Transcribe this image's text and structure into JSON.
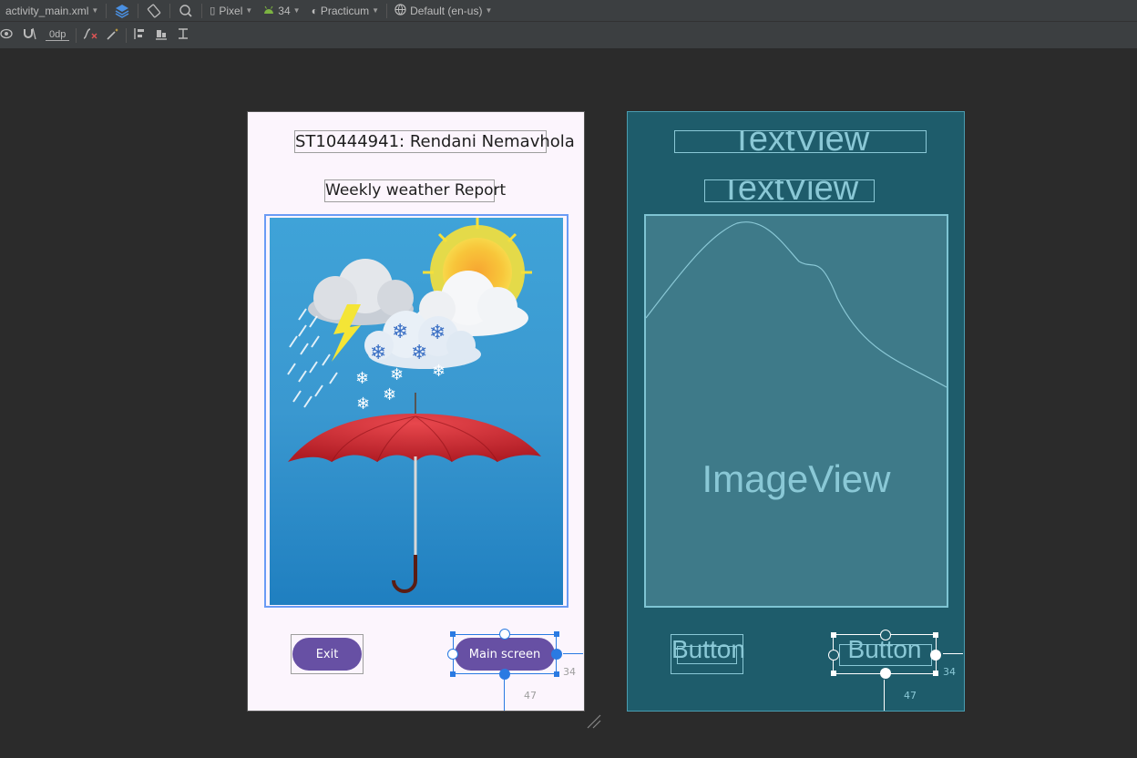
{
  "toolbar": {
    "file_name": "activity_main.xml",
    "device": "Pixel",
    "api_level": "34",
    "theme": "Practicum",
    "locale": "Default (en-us)",
    "margin_value": "0dp"
  },
  "design": {
    "title_text": "ST10444941: Rendani Nemavhola",
    "subtitle_text": "Weekly weather Report",
    "exit_button_label": "Exit",
    "main_button_label": "Main screen",
    "constraint_right": "34",
    "constraint_bottom": "47"
  },
  "blueprint": {
    "textview_label_1": "TextView",
    "textview_label_2": "TextView",
    "imageview_label": "ImageView",
    "button_label_1": "Button",
    "button_label_2": "Button",
    "constraint_right": "34",
    "constraint_bottom": "47"
  },
  "colors": {
    "button_purple": "#6750a4",
    "selection_blue": "#2a7ae2",
    "blueprint_bg": "#1e5c6b"
  }
}
